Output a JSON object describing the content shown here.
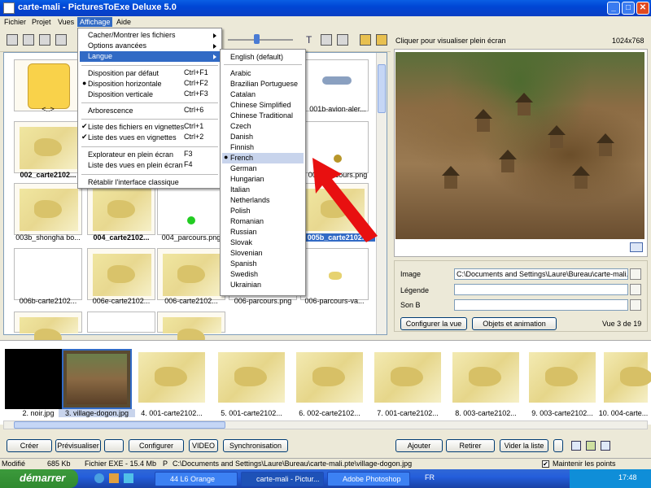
{
  "window": {
    "title": "carte-mali - PicturesToExe Deluxe 5.0"
  },
  "menubar": [
    "Fichier",
    "Projet",
    "Vues",
    "Affichage",
    "Aide"
  ],
  "affichage_menu": [
    {
      "label": "Cacher/Montrer les fichiers",
      "shortcut": "",
      "submenu": true
    },
    {
      "label": "Options avancées",
      "shortcut": "",
      "submenu": true
    },
    {
      "label": "Langue",
      "shortcut": "",
      "submenu": true,
      "highlighted": true
    },
    {
      "label": "Disposition par défaut",
      "shortcut": "Ctrl+F1"
    },
    {
      "label": "Disposition horizontale",
      "shortcut": "Ctrl+F2",
      "bullet": true
    },
    {
      "label": "Disposition verticale",
      "shortcut": "Ctrl+F3"
    },
    {
      "label": "Arborescence",
      "shortcut": "Ctrl+6"
    },
    {
      "label": "Liste des fichiers en vignettes",
      "shortcut": "Ctrl+1",
      "checked": true
    },
    {
      "label": "Liste des vues en vignettes",
      "shortcut": "Ctrl+2",
      "checked": true
    },
    {
      "label": "Explorateur en plein écran",
      "shortcut": "F3"
    },
    {
      "label": "Liste des vues en plein écran",
      "shortcut": "F4"
    },
    {
      "label": "Rétablir l'interface classique",
      "shortcut": ""
    }
  ],
  "langue_menu": [
    "English (default)",
    "Arabic",
    "Brazilian Portuguese",
    "Catalan",
    "Chinese Simplified",
    "Chinese Traditional",
    "Czech",
    "Danish",
    "Finnish",
    "French",
    "German",
    "Hungarian",
    "Italian",
    "Netherlands",
    "Polish",
    "Romanian",
    "Russian",
    "Slovak",
    "Slovenian",
    "Spanish",
    "Swedish",
    "Ukrainian"
  ],
  "langue_selected": "French",
  "file_captions": {
    "r1": [
      "<..>",
      "",
      "",
      "",
      "001b-avion-aler..."
    ],
    "r2": [
      "002_carte2102...",
      "",
      "",
      "",
      "002_parcours.png"
    ],
    "r3": [
      "003b_shongha bo...",
      "004_carte2102...",
      "004_parcours.png",
      "",
      "005b_carte2102..."
    ],
    "r4": [
      "006b-carte2102...",
      "006e-carte2102...",
      "006-carte2102...",
      "006-parcours.png",
      "006-parcours-va..."
    ]
  },
  "preview": {
    "hint": "Cliquer pour visualiser plein écran",
    "dims": "1024x768"
  },
  "props": {
    "image_label": "Image",
    "image_value": "C:\\Documents and Settings\\Laure\\Bureau\\carte-mali.ptf",
    "legende_label": "Légende",
    "son_label": "Son B",
    "configurer_btn": "Configurer la vue",
    "objets_btn": "Objets et animation",
    "vue_count": "Vue 3 de 19"
  },
  "filmstrip": [
    "2. noir.jpg",
    "3. village-dogon.jpg",
    "4. 001-carte2102...",
    "5. 001-carte2102...",
    "6. 002-carte2102...",
    "7. 001-carte2102...",
    "8. 003-carte2102...",
    "9. 003-carte2102...",
    "10. 004-carte..."
  ],
  "bottom_buttons": {
    "creer": "Créer",
    "previsualiser": "Prévisualiser",
    "configurer": "Configurer",
    "video": "VIDEO",
    "synchro": "Synchronisation",
    "ajouter": "Ajouter",
    "retirer": "Retirer",
    "vider": "Vider la liste"
  },
  "status": {
    "modifie": "Modifié",
    "size": "685 Kb",
    "exe": "Fichier EXE - 15.4 Mb",
    "p": "P",
    "path": "C:\\Documents and Settings\\Laure\\Bureau\\carte-mali.pte\\village-dogon.jpg",
    "maintenir": "Maintenir les points"
  },
  "taskbar": {
    "start": "démarrer",
    "items": [
      "44 L6 Orange",
      "carte-mali - Pictur...",
      "Adobe Photoshop"
    ],
    "lang": "FR",
    "clock": "17:48"
  }
}
